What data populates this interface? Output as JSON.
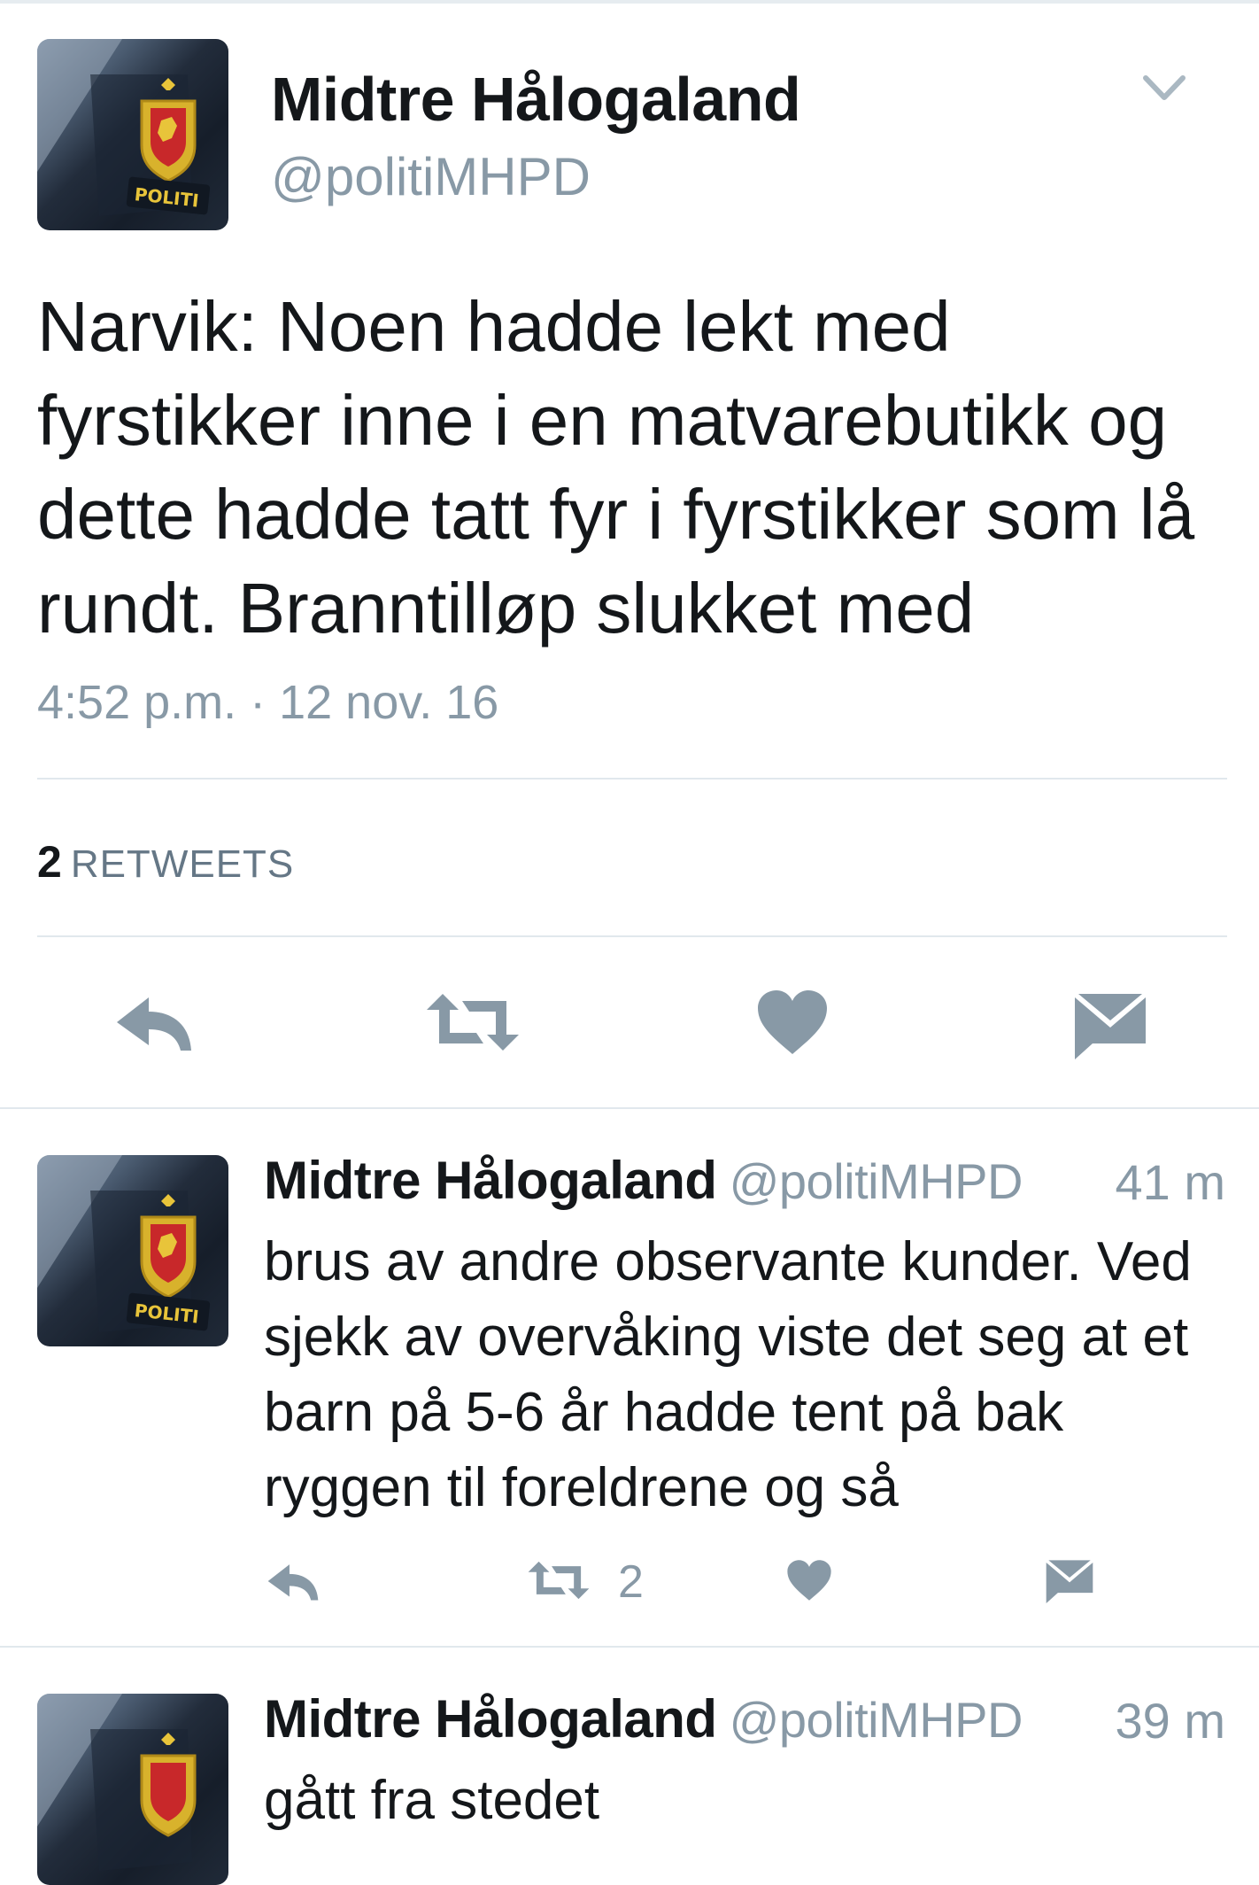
{
  "colors": {
    "icon_gray": "#8899a6",
    "text_dark": "#14171a",
    "divider": "#e1e8ed"
  },
  "avatar": {
    "badge_text": "POLITI"
  },
  "main_tweet": {
    "name": "Midtre Hålogaland",
    "handle": "@politiMHPD",
    "menu_icon": "chevron-down-icon",
    "text_lines": [
      "Narvik: Noen hadde lekt med",
      "fyrstikker inne i en matvarebutikk og",
      "dette hadde tatt fyr i fyrstikker som lå",
      "rundt. Branntilløp slukket med"
    ],
    "timestamp": "4:52 p.m. · 12 nov. 16",
    "retweet_count": "2",
    "retweet_label": "RETWEETS",
    "actions": [
      "reply-icon",
      "retweet-icon",
      "heart-icon",
      "envelope-icon"
    ]
  },
  "replies": [
    {
      "name": "Midtre Hålogaland",
      "handle": "@politiMHPD",
      "time": "41 m",
      "text_lines": [
        "brus av andre observante kunder. Ved",
        "sjekk av overvåking viste det seg at et",
        "barn på 5-6 år hadde tent på bak",
        "ryggen til foreldrene og så"
      ],
      "retweet_count": "2"
    },
    {
      "name": "Midtre Hålogaland",
      "handle": "@politiMHPD",
      "time": "39 m",
      "text_lines": [
        "gått fra stedet"
      ]
    }
  ]
}
